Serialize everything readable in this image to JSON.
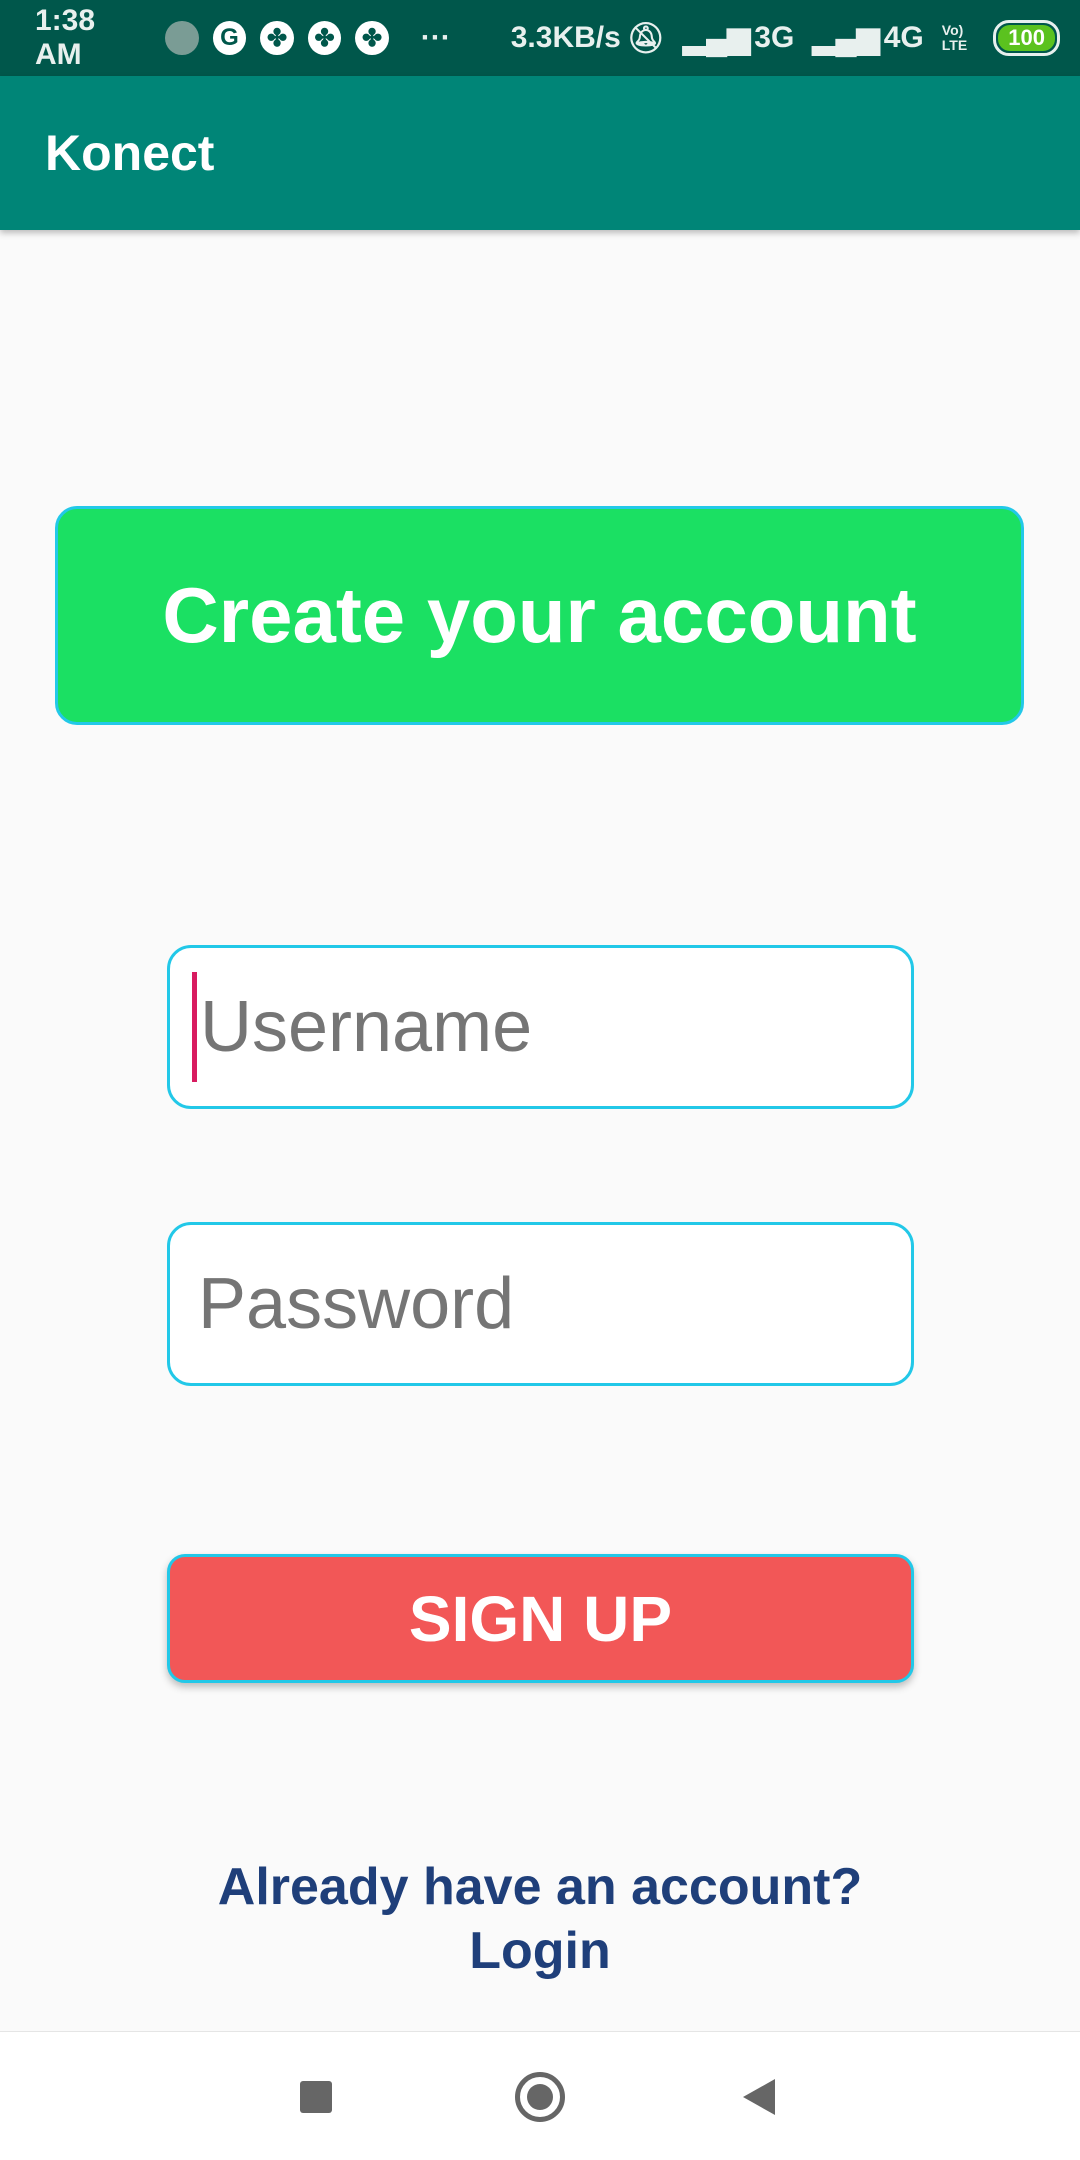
{
  "status_bar": {
    "time": "1:38 AM",
    "speed": "3.3KB/s",
    "net1": "3G",
    "net2": "4G",
    "volte": "Vo) LTE",
    "battery": "100"
  },
  "app_bar": {
    "title": "Konect"
  },
  "banner": {
    "text": "Create your account"
  },
  "form": {
    "username_placeholder": "Username",
    "password_placeholder": "Password",
    "signup_label": "SIGN UP"
  },
  "login_link": {
    "line1": "Already have an account?",
    "line2": "Login"
  }
}
